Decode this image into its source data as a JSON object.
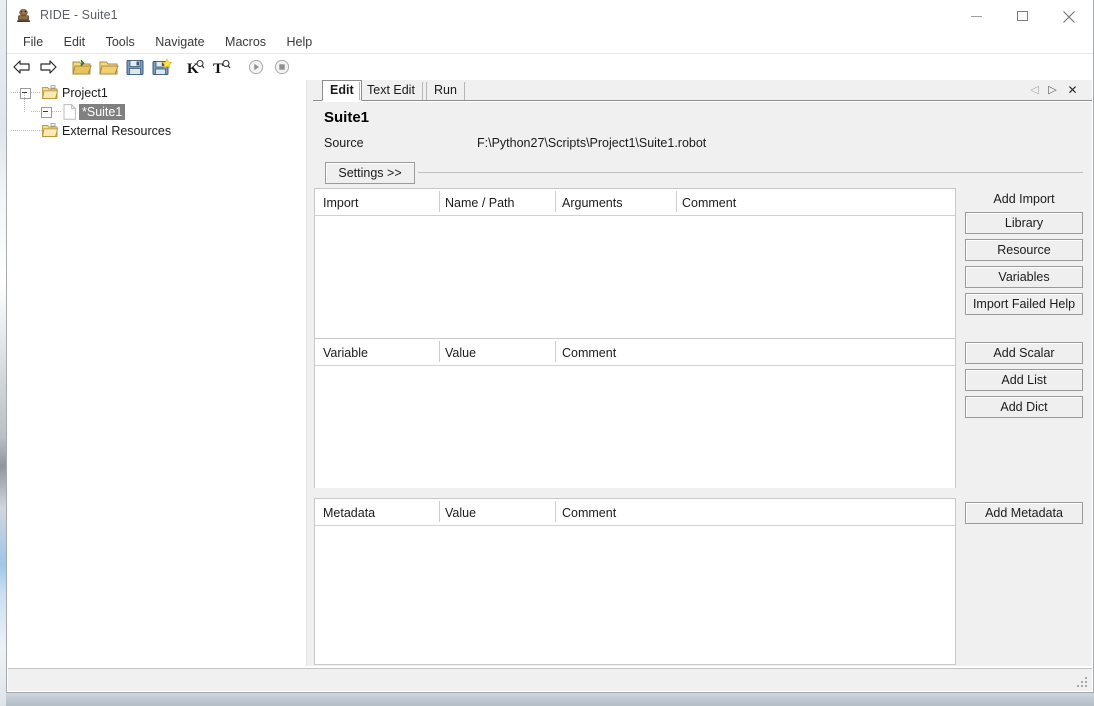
{
  "window": {
    "title": "RIDE - Suite1",
    "app_icon": "robot-icon",
    "controls": {
      "minimize": "minimize-icon",
      "maximize": "maximize-icon",
      "close": "close-icon"
    }
  },
  "menubar": {
    "items": [
      {
        "label": "File"
      },
      {
        "label": "Edit"
      },
      {
        "label": "Tools"
      },
      {
        "label": "Navigate"
      },
      {
        "label": "Macros"
      },
      {
        "label": "Help"
      }
    ]
  },
  "toolbar": {
    "buttons": [
      {
        "name": "back-arrow-icon",
        "title": "Back"
      },
      {
        "name": "forward-arrow-icon",
        "title": "Forward"
      },
      {
        "name": "new-project-folder-icon",
        "title": "New Project"
      },
      {
        "name": "open-folder-icon",
        "title": "Open"
      },
      {
        "name": "save-icon",
        "title": "Save"
      },
      {
        "name": "save-all-icon",
        "title": "Save All"
      },
      {
        "name": "search-keyword-icon",
        "title": "Search Keyword"
      },
      {
        "name": "search-tests-icon",
        "title": "Search Tests"
      },
      {
        "name": "run-icon",
        "title": "Run"
      },
      {
        "name": "stop-icon",
        "title": "Stop"
      }
    ]
  },
  "tree": {
    "nodes": [
      {
        "label": "Project1",
        "icon": "project-folder-icon",
        "expanded": true,
        "selected": false
      },
      {
        "label": "*Suite1",
        "icon": "suite-file-icon",
        "expanded": true,
        "selected": true
      },
      {
        "label": "External Resources",
        "icon": "resource-folder-icon",
        "expanded": false,
        "selected": false
      }
    ]
  },
  "editor": {
    "tabs": [
      {
        "label": "Edit",
        "active": true
      },
      {
        "label": "Text Edit",
        "active": false
      },
      {
        "label": "Run",
        "active": false
      }
    ],
    "tab_nav": {
      "prev": "◁",
      "next": "▷",
      "close": "✕"
    },
    "suite_name": "Suite1",
    "source_label": "Source",
    "source_value": "F:\\Python27\\Scripts\\Project1\\Suite1.robot",
    "settings_button": "Settings >>",
    "import_grid": {
      "headers": [
        "Import",
        "Name / Path",
        "Arguments",
        "Comment"
      ],
      "rows": []
    },
    "variable_grid": {
      "headers": [
        "Variable",
        "Value",
        "Comment"
      ],
      "rows": []
    },
    "metadata_grid": {
      "headers": [
        "Metadata",
        "Value",
        "Comment"
      ],
      "rows": []
    },
    "side_panel": {
      "add_import_label": "Add Import",
      "import_buttons": [
        {
          "label": "Library"
        },
        {
          "label": "Resource"
        },
        {
          "label": "Variables"
        },
        {
          "label": "Import Failed Help"
        }
      ],
      "variable_buttons": [
        {
          "label": "Add Scalar"
        },
        {
          "label": "Add List"
        },
        {
          "label": "Add Dict"
        }
      ],
      "metadata_buttons": [
        {
          "label": "Add Metadata"
        }
      ]
    }
  },
  "statusbar": {
    "text": ""
  },
  "colors": {
    "window_bg": "#ffffff",
    "panel_bg": "#f0f0f0",
    "grid_bg": "#ffffff",
    "selection_bg": "#808080",
    "selection_fg": "#ffffff",
    "border": "#9a9a9a",
    "text": "#1b1b1b"
  }
}
